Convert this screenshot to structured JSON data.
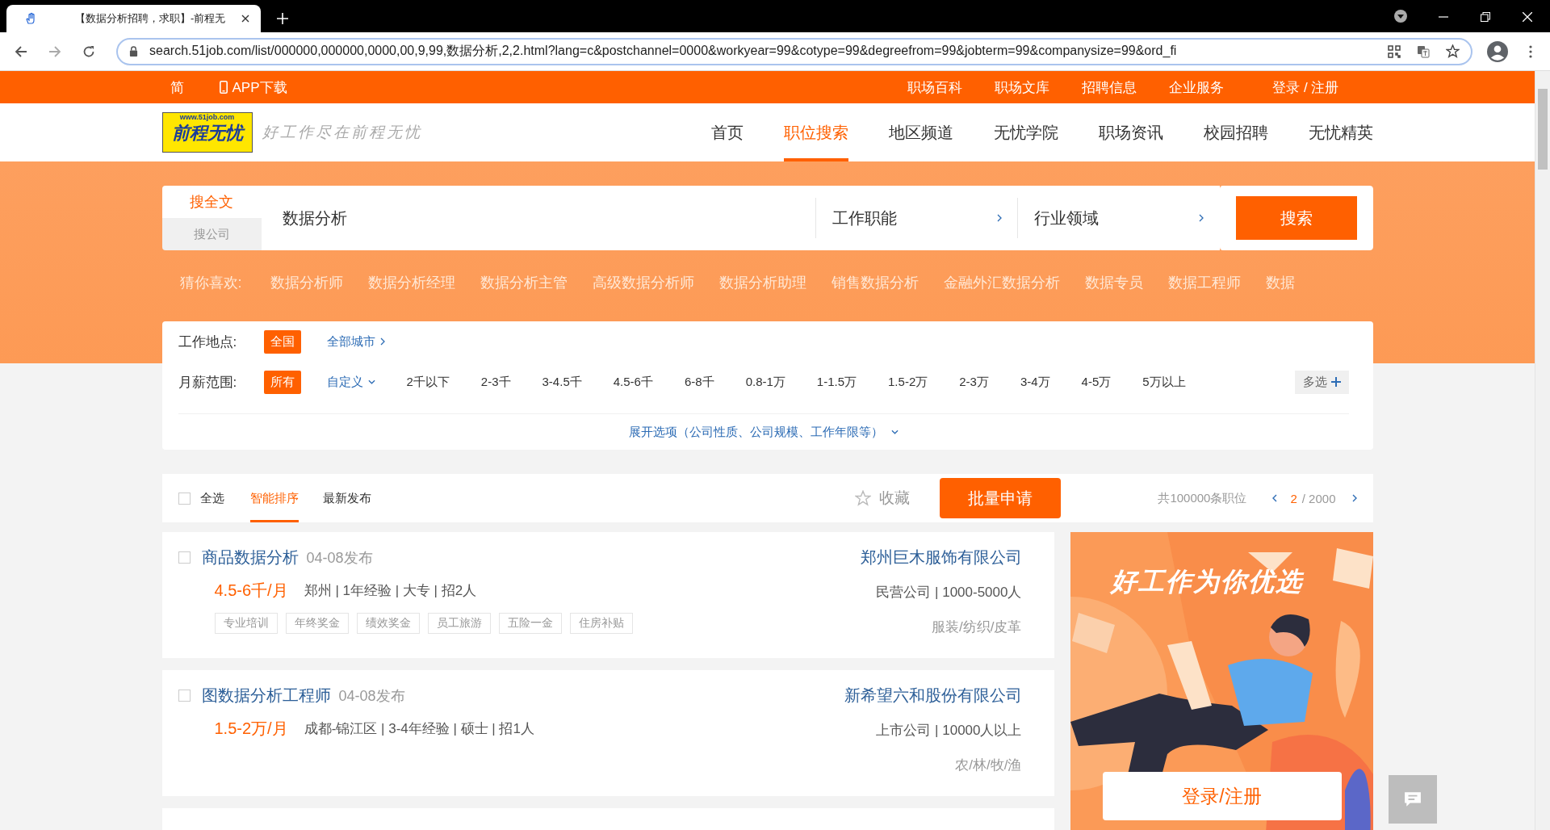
{
  "browser": {
    "tab_title": "【数据分析招聘，求职】-前程无",
    "url": "search.51job.com/list/000000,000000,0000,00,9,99,数据分析,2,2.html?lang=c&postchannel=0000&workyear=99&cotype=99&degreefrom=99&jobterm=99&companysize=99&ord_fi"
  },
  "topbar": {
    "lang": "简",
    "app": "APP下载",
    "links": [
      "职场百科",
      "职场文库",
      "招聘信息",
      "企业服务"
    ],
    "login": "登录 / 注册"
  },
  "header": {
    "logo_site": "www.51job.com",
    "logo_name": "前程无忧",
    "slogan": "好工作尽在前程无忧",
    "nav": [
      {
        "label": "首页",
        "selected": false
      },
      {
        "label": "职位搜索",
        "selected": true
      },
      {
        "label": "地区频道",
        "selected": false
      },
      {
        "label": "无忧学院",
        "selected": false
      },
      {
        "label": "职场资讯",
        "selected": false
      },
      {
        "label": "校园招聘",
        "selected": false
      },
      {
        "label": "无忧精英",
        "selected": false
      }
    ]
  },
  "search": {
    "modes": [
      {
        "label": "搜全文",
        "selected": true
      },
      {
        "label": "搜公司",
        "selected": false
      }
    ],
    "query": "数据分析",
    "selectors": [
      "工作职能",
      "行业领域"
    ],
    "button": "搜索"
  },
  "suggestions": {
    "label": "猜你喜欢:",
    "items": [
      "数据分析师",
      "数据分析经理",
      "数据分析主管",
      "高级数据分析师",
      "数据分析助理",
      "销售数据分析",
      "金融外汇数据分析",
      "数据专员",
      "数据工程师",
      "数据"
    ]
  },
  "filters": {
    "location": {
      "label": "工作地点:",
      "options": [
        {
          "label": "全国",
          "selected": true,
          "kind": "option"
        },
        {
          "label": "全部城市",
          "kind": "link"
        }
      ]
    },
    "salary": {
      "label": "月薪范围:",
      "options": [
        {
          "label": "所有",
          "selected": true,
          "kind": "option"
        },
        {
          "label": "自定义",
          "kind": "dropdown"
        },
        {
          "label": "2千以下",
          "selected": false,
          "kind": "option"
        },
        {
          "label": "2-3千",
          "selected": false,
          "kind": "option"
        },
        {
          "label": "3-4.5千",
          "selected": false,
          "kind": "option"
        },
        {
          "label": "4.5-6千",
          "selected": false,
          "kind": "option"
        },
        {
          "label": "6-8千",
          "selected": false,
          "kind": "option"
        },
        {
          "label": "0.8-1万",
          "selected": false,
          "kind": "option"
        },
        {
          "label": "1-1.5万",
          "selected": false,
          "kind": "option"
        },
        {
          "label": "1.5-2万",
          "selected": false,
          "kind": "option"
        },
        {
          "label": "2-3万",
          "selected": false,
          "kind": "option"
        },
        {
          "label": "3-4万",
          "selected": false,
          "kind": "option"
        },
        {
          "label": "4-5万",
          "selected": false,
          "kind": "option"
        },
        {
          "label": "5万以上",
          "selected": false,
          "kind": "option"
        }
      ],
      "multi": "多选"
    },
    "expand": "展开选项（公司性质、公司规模、工作年限等）"
  },
  "sortbar": {
    "select_all": {
      "label": "全选",
      "checked": false
    },
    "sorts": [
      {
        "label": "智能排序",
        "selected": true
      },
      {
        "label": "最新发布",
        "selected": false
      }
    ],
    "favorite": "收藏",
    "batch": "批量申请",
    "total": "共100000条职位",
    "page": "2",
    "pages": "/ 2000"
  },
  "jobs": [
    {
      "checked": false,
      "title": "商品数据分析",
      "date": "04-08发布",
      "salary": "4.5-6千/月",
      "meta": "郑州 | 1年经验 | 大专 | 招2人",
      "company": "郑州巨木服饰有限公司",
      "company_meta": "民营公司 | 1000-5000人",
      "industry": "服装/纺织/皮革",
      "tags": [
        "专业培训",
        "年终奖金",
        "绩效奖金",
        "员工旅游",
        "五险一金",
        "住房补贴"
      ]
    },
    {
      "checked": false,
      "title": "图数据分析工程师",
      "date": "04-08发布",
      "salary": "1.5-2万/月",
      "meta": "成都-锦江区 | 3-4年经验 | 硕士 | 招1人",
      "company": "新希望六和股份有限公司",
      "company_meta": "上市公司 | 10000人以上",
      "industry": "农/林/牧/渔"
    }
  ],
  "promo": {
    "headline": "好工作为你优选",
    "button": "登录/注册"
  }
}
